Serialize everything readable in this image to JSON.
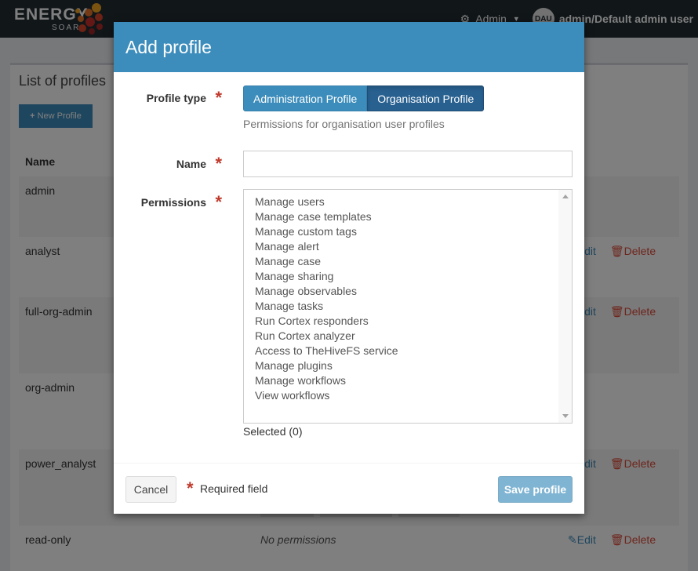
{
  "topbar": {
    "brand_main": "ENERGY",
    "brand_sub": "SOAR",
    "admin_menu_label": "Admin",
    "avatar_initials": "DAU",
    "user_label": "admin/Default admin user"
  },
  "page": {
    "title": "List of profiles",
    "new_profile_label": "New Profile",
    "column_name": "Name",
    "edit_label": "Edit",
    "delete_label": "Delete",
    "profiles": [
      {
        "name": "admin"
      },
      {
        "name": "analyst"
      },
      {
        "name": "full-org-admin"
      },
      {
        "name": "org-admin"
      },
      {
        "name": "power_analyst"
      },
      {
        "name": "read-only",
        "permissions_text": "No permissions"
      }
    ]
  },
  "modal": {
    "title": "Add profile",
    "profile_type_label": "Profile type",
    "profile_type_options": [
      "Administration Profile",
      "Organisation Profile"
    ],
    "profile_type_selected": "Organisation Profile",
    "profile_type_help": "Permissions for organisation user profiles",
    "name_label": "Name",
    "name_value": "",
    "permissions_label": "Permissions",
    "permissions": [
      "Manage users",
      "Manage case templates",
      "Manage custom tags",
      "Manage alert",
      "Manage case",
      "Manage sharing",
      "Manage observables",
      "Manage tasks",
      "Run Cortex responders",
      "Run Cortex analyzer",
      "Access to TheHiveFS service",
      "Manage plugins",
      "Manage workflows",
      "View workflows"
    ],
    "selected_text": "Selected (0)",
    "cancel_label": "Cancel",
    "required_note": "Required field",
    "save_label": "Save profile"
  },
  "colors": {
    "primary": "#3c8dbc",
    "primary_active": "#286090",
    "danger": "#dd4b39",
    "required": "#c0392b",
    "topbar": "#222d32"
  }
}
